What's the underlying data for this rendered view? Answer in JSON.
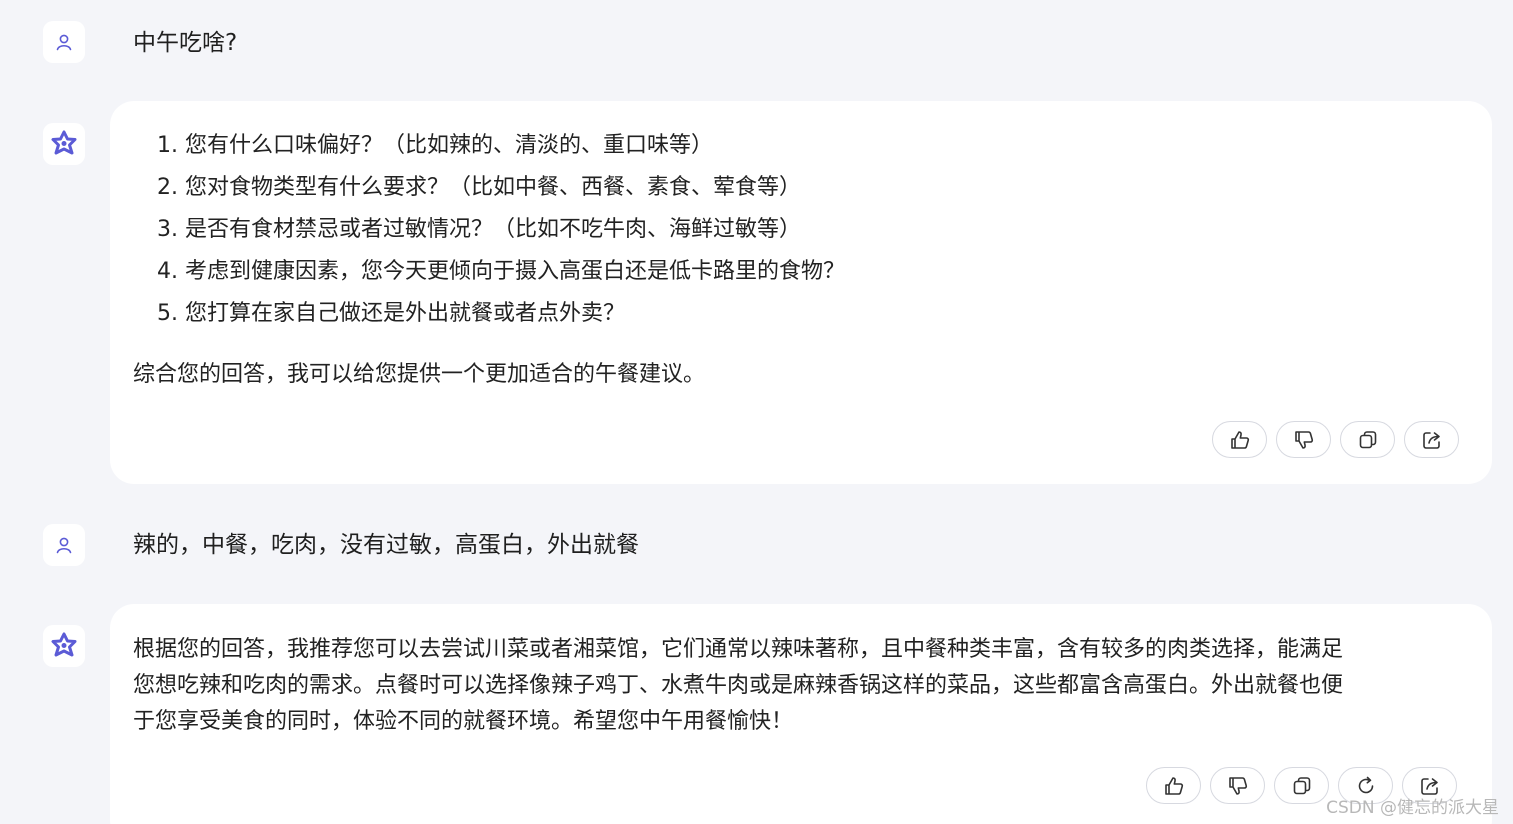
{
  "messages": {
    "q1": "中午吃啥?",
    "a1": {
      "list": [
        "1. 您有什么口味偏好？（比如辣的、清淡的、重口味等）",
        "2. 您对食物类型有什么要求？（比如中餐、西餐、素食、荤食等）",
        "3. 是否有食材禁忌或者过敏情况？（比如不吃牛肉、海鲜过敏等）",
        "4. 考虑到健康因素，您今天更倾向于摄入高蛋白还是低卡路里的食物？",
        "5. 您打算在家自己做还是外出就餐或者点外卖？"
      ],
      "summary": "综合您的回答，我可以给您提供一个更加适合的午餐建议。"
    },
    "q2": "辣的，中餐，吃肉，没有过敏，高蛋白，外出就餐",
    "a2": {
      "lines": [
        "根据您的回答，我推荐您可以去尝试川菜或者湘菜馆，它们通常以辣味著称，且中餐种类丰富，含有较多的肉类选择，能满足",
        "您想吃辣和吃肉的需求。点餐时可以选择像辣子鸡丁、水煮牛肉或是麻辣香锅这样的菜品，这些都富含高蛋白。外出就餐也便",
        "于您享受美食的同时，体验不同的就餐环境。希望您中午用餐愉快！"
      ]
    }
  },
  "icons": {
    "user_avatar": "user-icon",
    "assistant_avatar": "assistant-logo-icon",
    "like": "thumbs-up-icon",
    "dislike": "thumbs-down-icon",
    "copy": "copy-icon",
    "regenerate": "refresh-icon",
    "share": "share-icon"
  },
  "colors": {
    "background": "#f4f5f9",
    "bubble": "#ffffff",
    "accent": "#5b5bd6"
  },
  "watermark": "CSDN @健忘的派大星"
}
